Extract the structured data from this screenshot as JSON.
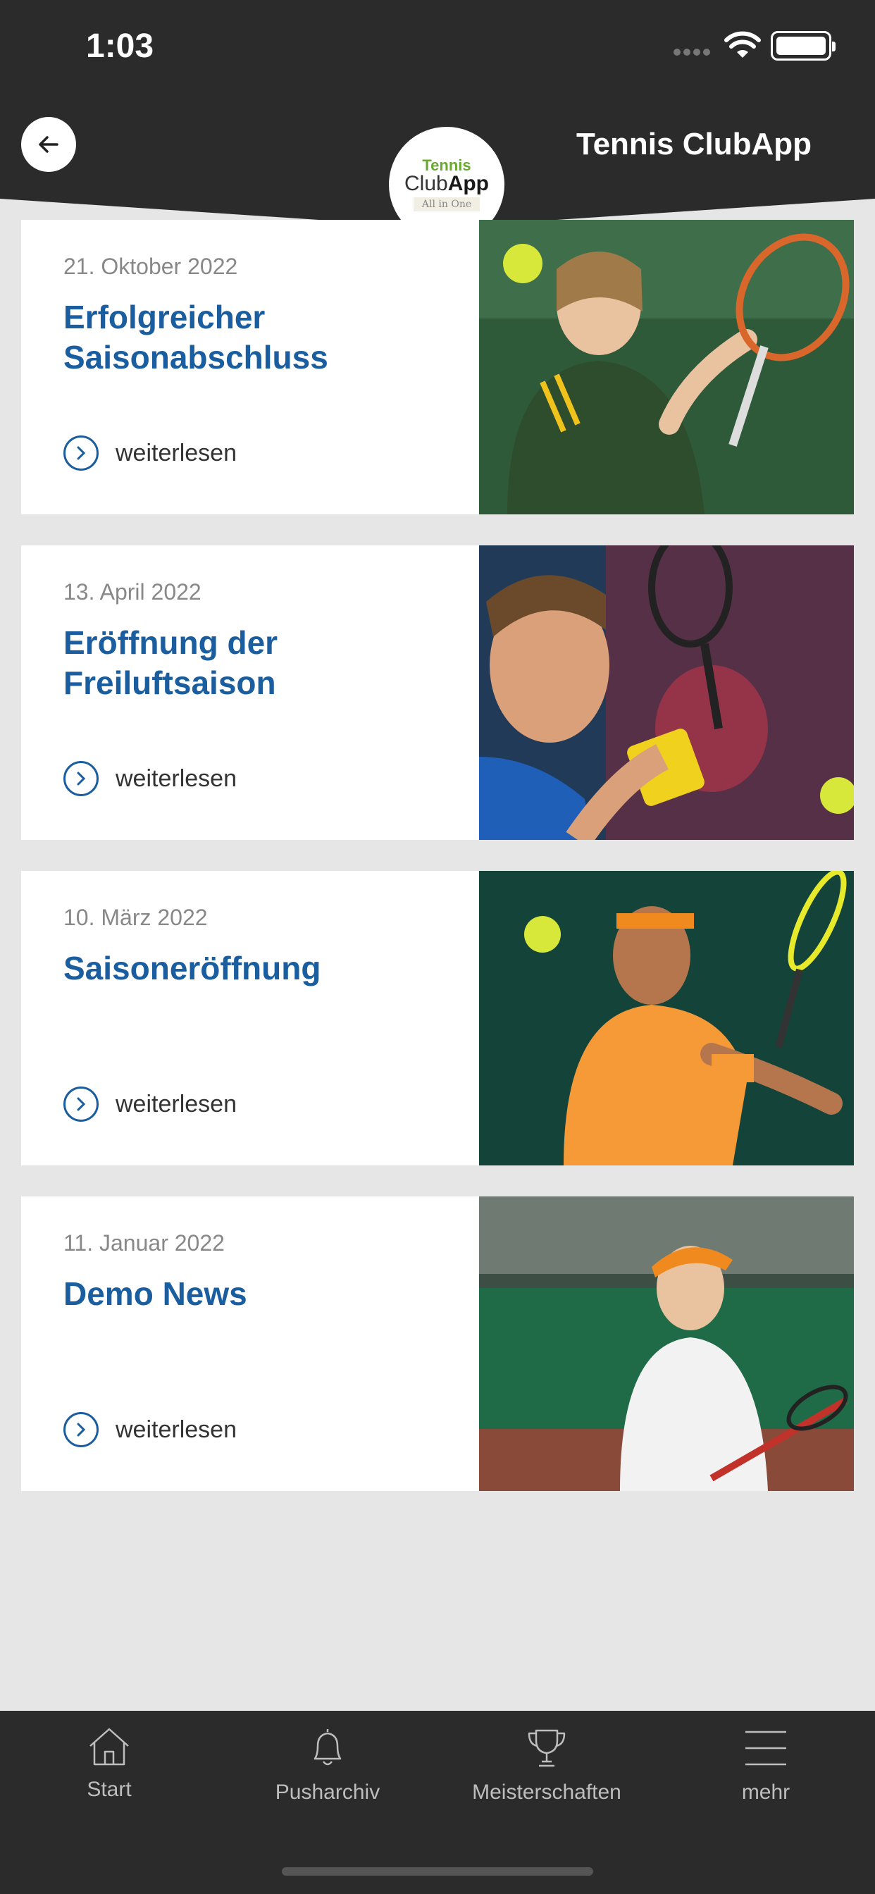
{
  "status_bar": {
    "time": "1:03"
  },
  "header": {
    "title": "Tennis ClubApp",
    "logo": {
      "line1": "Tennis",
      "line2_club": "Club",
      "line2_app": "App",
      "line3": "All in One"
    }
  },
  "news": [
    {
      "date": "21. Oktober 2022",
      "title": "Erfolgreicher Saisonabschluss",
      "more": "weiterlesen",
      "image": "tennis-player-woman-green"
    },
    {
      "date": "13. April 2022",
      "title": "Eröffnung der Freiluftsaison",
      "more": "weiterlesen",
      "image": "tennis-player-man-blue"
    },
    {
      "date": "10. März 2022",
      "title": "Saisoneröffnung",
      "more": "weiterlesen",
      "image": "tennis-player-man-orange"
    },
    {
      "date": "11. Januar 2022",
      "title": "Demo News",
      "more": "weiterlesen",
      "image": "tennis-player-woman-white"
    }
  ],
  "tabbar": {
    "items": [
      {
        "label": "Start",
        "icon": "home-icon"
      },
      {
        "label": "Pusharchiv",
        "icon": "bell-icon"
      },
      {
        "label": "Meisterschaften",
        "icon": "trophy-icon"
      },
      {
        "label": "mehr",
        "icon": "menu-icon"
      }
    ]
  },
  "colors": {
    "header": "#2b2b2b",
    "accent": "#1b5ea0",
    "background": "#e6e6e6"
  }
}
